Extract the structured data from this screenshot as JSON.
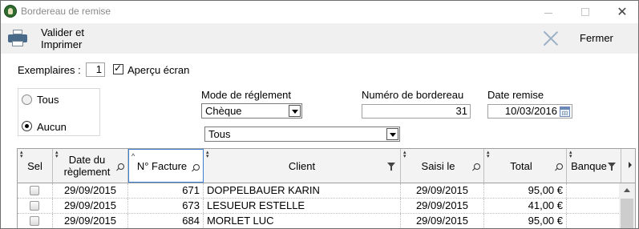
{
  "window": {
    "title": "Bordereau de remise"
  },
  "toolbar": {
    "validate_label": "Valider et Imprimer",
    "close_label": "Fermer"
  },
  "form": {
    "copies_label": "Exemplaires :",
    "copies_value": "1",
    "preview_label": "Aperçu écran",
    "preview_checked": true,
    "radio_all_label": "Tous",
    "radio_none_label": "Aucun",
    "radio_selected": "Aucun",
    "payment_mode_label": "Mode de réglement",
    "payment_mode_value": "Chèque",
    "filter_value": "Tous",
    "slip_number_label": "Numéro de bordereau",
    "slip_number_value": "31",
    "date_label": "Date remise",
    "date_value": "10/03/2016"
  },
  "table": {
    "columns": [
      "Sel",
      "Date du règlement",
      "N° Facture",
      "Client",
      "Saisi le",
      "Total",
      "Banque"
    ],
    "rows": [
      {
        "sel": false,
        "date": "29/09/2015",
        "invoice": "671",
        "client": "DOPPELBAUER KARIN",
        "entered": "29/09/2015",
        "total": "95,00 €",
        "bank": ""
      },
      {
        "sel": false,
        "date": "29/09/2015",
        "invoice": "673",
        "client": "LESUEUR ESTELLE",
        "entered": "29/09/2015",
        "total": "41,00 €",
        "bank": ""
      },
      {
        "sel": false,
        "date": "29/09/2015",
        "invoice": "684",
        "client": "MORLET LUC",
        "entered": "29/09/2015",
        "total": "95,00 €",
        "bank": ""
      }
    ]
  },
  "icons": {
    "app": "app-icon",
    "printer": "printer-icon",
    "close": "close-x-icon",
    "calendar": "calendar-icon",
    "search": "search-icon",
    "filter": "filter-icon"
  },
  "colors": {
    "toolbar_bg": "#f0f0f0",
    "focus_border": "#3c7fd0",
    "title_text": "#8a8a8a"
  }
}
